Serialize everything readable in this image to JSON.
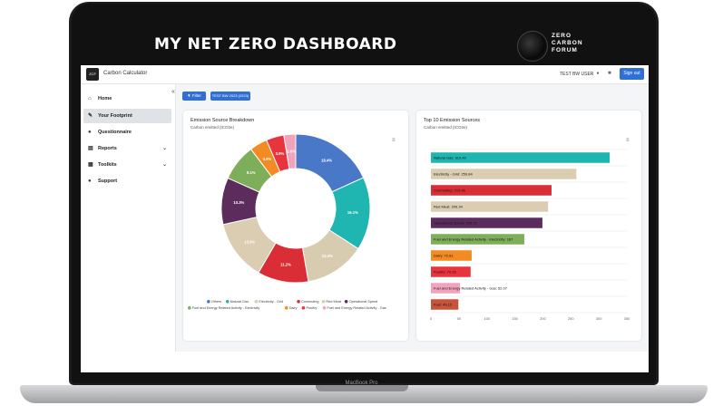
{
  "banner": {
    "title": "MY NET ZERO DASHBOARD",
    "logo_lines": [
      "ZERO",
      "CARBON",
      "FORUM"
    ]
  },
  "laptop": {
    "model": "MacBook Pro"
  },
  "app": {
    "logo_text": "ZCF",
    "title": "Carbon Calculator",
    "user": "TEST BW USER",
    "sign_out": "Sign out",
    "collapse": "«"
  },
  "sidebar": {
    "items": [
      {
        "label": "Home",
        "icon": "home-icon",
        "glyph": "⌂"
      },
      {
        "label": "Your Footprint",
        "icon": "footprint-icon",
        "glyph": "✎"
      },
      {
        "label": "Questionnaire",
        "icon": "questionnaire-icon",
        "glyph": "●"
      },
      {
        "label": "Reports",
        "icon": "reports-icon",
        "glyph": "▤",
        "chevron": "⌄"
      },
      {
        "label": "Toolkits",
        "icon": "toolkits-icon",
        "glyph": "▦",
        "chevron": "⌄"
      },
      {
        "label": "Support",
        "icon": "support-icon",
        "glyph": "●"
      }
    ],
    "active_index": 1
  },
  "toolbar": {
    "filter": "Filter",
    "chip": "TEST BW 2023 (2023)"
  },
  "colors": {
    "accent": "#2f6fd6",
    "series": [
      "#4a78c8",
      "#1fb5b0",
      "#d8ccb0",
      "#d92e35",
      "#dacdb2",
      "#5c2d5c",
      "#7fae5a",
      "#f38b22",
      "#e8343d",
      "#f2a3bc"
    ]
  },
  "donut_card": {
    "title": "Emission Source Breakdown",
    "subtitle": "Carbon emitted (tCO2e)",
    "menu": "≡",
    "chart_data": {
      "type": "pie",
      "title": "Emission Source Breakdown",
      "slices": [
        {
          "name": "Others",
          "value": 18.4,
          "label": "18.4%"
        },
        {
          "name": "Natural Gas",
          "value": 16.1,
          "label": "16.1%"
        },
        {
          "name": "Electricity - Grid",
          "value": 13.3,
          "label": "13.3%"
        },
        {
          "name": "Commuting",
          "value": 11.2,
          "label": "11.2%"
        },
        {
          "name": "Red Meat",
          "value": 13.3,
          "label": "13.3%"
        },
        {
          "name": "Operational Spend",
          "value": 10.3,
          "label": "10.3%"
        },
        {
          "name": "Fuel and Energy Related Activity - Electricity",
          "value": 8.1,
          "label": "8.1%"
        },
        {
          "name": "Dairy",
          "value": 3.9,
          "label": "3.9%"
        },
        {
          "name": "Poultry",
          "value": 3.9,
          "label": "3.9%"
        },
        {
          "name": "Fuel and Energy Related Activity - Gas",
          "value": 2.6,
          "label": "2.6%"
        }
      ],
      "legend": [
        "Others",
        "Natural Gas",
        "Electricity - Grid",
        "Commuting",
        "Red Meat",
        "Operational Spend",
        "Fuel and Energy Related Activity - Electricity",
        "Dairy",
        "Poultry",
        "Fuel and Energy Related Activity - Gas"
      ],
      "legend_placement": "bottom"
    }
  },
  "bar_card": {
    "title": "Top 10 Emission Sources",
    "subtitle": "Carbon emitted (tCO2e)",
    "menu": "≡",
    "chart_data": {
      "type": "bar",
      "orientation": "horizontal",
      "title": "Top 10 Emission Sources",
      "categories": [
        "Natural Gas",
        "Electricity - Grid",
        "Commuting",
        "Red Meat",
        "Operational Spend",
        "Fuel and Energy Related Activity - Electricity",
        "Dairy",
        "Poultry",
        "Fuel and Energy Related Activity - Gas",
        "Fuel"
      ],
      "values": [
        319.4,
        259.84,
        215.46,
        209.34,
        199.19,
        167,
        72.81,
        70.95,
        52.07,
        49.12
      ],
      "labels": [
        "Natural Gas: 319.40",
        "Electricity - Grid: 259.84",
        "Commuting: 215.46",
        "Red Meat: 209.34",
        "Operational Spend: 199.19",
        "Fuel and Energy Related Activity - Electricity: 167",
        "Dairy: 72.81",
        "Poultry: 70.95",
        "Fuel and Energy Related Activity - Gas: 52.07",
        "Fuel: 49.12"
      ],
      "xlim": [
        0,
        350
      ],
      "xticks": [
        0,
        50,
        100,
        150,
        200,
        250,
        300,
        350
      ],
      "grid": true
    }
  }
}
